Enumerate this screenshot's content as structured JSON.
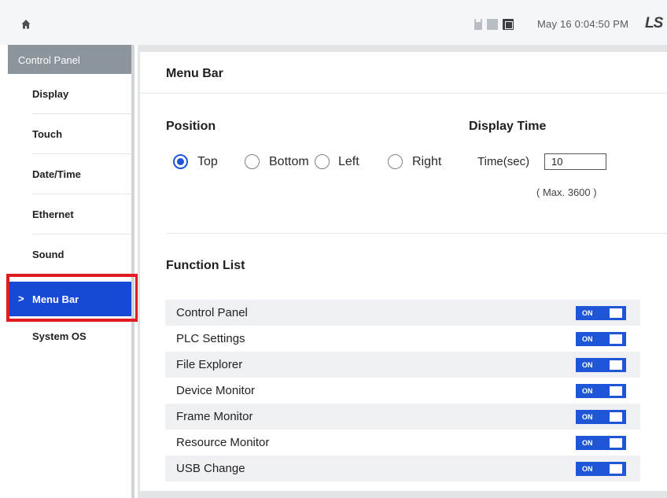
{
  "topbar": {
    "datetime": "May 16 0:04:50 PM",
    "logo_text": "LS",
    "icons": [
      "home-icon",
      "sd-card-icon",
      "sd-card-icon",
      "usb-icon"
    ]
  },
  "sidebar": {
    "header": "Control Panel",
    "items": [
      {
        "label": "Display"
      },
      {
        "label": "Touch"
      },
      {
        "label": "Date/Time"
      },
      {
        "label": "Ethernet"
      },
      {
        "label": "Sound"
      },
      {
        "label": "Menu Bar",
        "active": true,
        "chevron": ">"
      },
      {
        "label": "System OS"
      }
    ]
  },
  "main": {
    "title": "Menu Bar",
    "position": {
      "label": "Position",
      "options": [
        "Top",
        "Bottom",
        "Left",
        "Right"
      ],
      "selected": "Top"
    },
    "display_time": {
      "label": "Display Time",
      "field_label": "Time(sec)",
      "value": "10",
      "max_note": "( Max. 3600 )"
    },
    "function_list": {
      "label": "Function List",
      "items": [
        {
          "name": "Control Panel",
          "state": "ON"
        },
        {
          "name": "PLC Settings",
          "state": "ON"
        },
        {
          "name": "File Explorer",
          "state": "ON"
        },
        {
          "name": "Device Monitor",
          "state": "ON"
        },
        {
          "name": "Frame Monitor",
          "state": "ON"
        },
        {
          "name": "Resource Monitor",
          "state": "ON"
        },
        {
          "name": "USB Change",
          "state": "ON"
        }
      ]
    }
  },
  "colors": {
    "accent": "#1f56d8",
    "sidebar_active": "#1549d6",
    "highlight": "#e11b22",
    "sidebar_header": "#8d959c"
  }
}
